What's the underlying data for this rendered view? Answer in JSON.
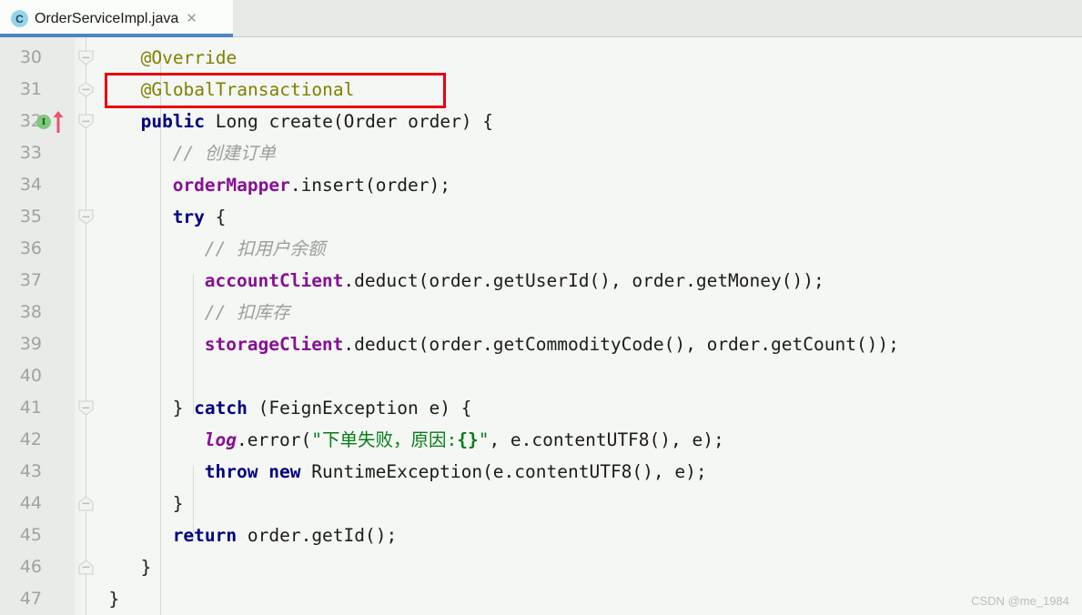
{
  "window": {
    "app": "IntelliJ IDEA Editor",
    "watermark": "CSDN @me_1984"
  },
  "tab": {
    "title": "OrderServiceImpl.java",
    "icon": "java-class-icon",
    "icon_letter": "C",
    "close_label": "✕",
    "active": true,
    "accent_color": "#4a86c4"
  },
  "colors": {
    "editor_background": "#f4f7f3",
    "gutter_background": "#e9ebe8",
    "line_number": "#9ea3a0",
    "keyword": "#000080",
    "annotation": "#808000",
    "comment": "#9aa09b",
    "field": "#871094",
    "string": "#067d17",
    "plain_text": "#1b1b1b",
    "highlight_box": "#e60012",
    "tab_accent": "#4a86c4"
  },
  "gutter": {
    "markers": [
      {
        "line": 32,
        "type": "implementing-method-badge",
        "letter": "I",
        "color": "#7dc97a"
      },
      {
        "line": 32,
        "type": "override-arrow",
        "color": "#e8566f"
      }
    ],
    "fold_handles": [
      {
        "line": 30,
        "shape": "down"
      },
      {
        "line": 31,
        "shape": "both"
      },
      {
        "line": 32,
        "shape": "down"
      },
      {
        "line": 35,
        "shape": "down"
      },
      {
        "line": 41,
        "shape": "down"
      },
      {
        "line": 44,
        "shape": "up"
      },
      {
        "line": 46,
        "shape": "up"
      }
    ]
  },
  "highlight": {
    "target_line": 31,
    "label": "GlobalTransactional annotation highlight"
  },
  "code": {
    "first_line_number": 30,
    "line_height_px": 35,
    "lines": [
      {
        "n": 30,
        "indent": 8,
        "tokens": [
          {
            "t": "@Override",
            "c": "anno"
          }
        ]
      },
      {
        "n": 31,
        "indent": 8,
        "tokens": [
          {
            "t": "@GlobalTransactional",
            "c": "anno"
          }
        ]
      },
      {
        "n": 32,
        "indent": 8,
        "tokens": [
          {
            "t": "public",
            "c": "kw"
          },
          {
            "t": " Long create(Order order) {",
            "c": "plain"
          }
        ]
      },
      {
        "n": 33,
        "indent": 11,
        "tokens": [
          {
            "t": "// 创建订单",
            "c": "comment"
          }
        ]
      },
      {
        "n": 34,
        "indent": 11,
        "tokens": [
          {
            "t": "orderMapper",
            "c": "field"
          },
          {
            "t": ".insert(order);",
            "c": "plain"
          }
        ]
      },
      {
        "n": 35,
        "indent": 11,
        "tokens": [
          {
            "t": "try",
            "c": "kw"
          },
          {
            "t": " {",
            "c": "plain"
          }
        ]
      },
      {
        "n": 36,
        "indent": 14,
        "tokens": [
          {
            "t": "// 扣用户余额",
            "c": "comment"
          }
        ]
      },
      {
        "n": 37,
        "indent": 14,
        "tokens": [
          {
            "t": "accountClient",
            "c": "field"
          },
          {
            "t": ".deduct(order.getUserId(), order.getMoney());",
            "c": "plain"
          }
        ]
      },
      {
        "n": 38,
        "indent": 14,
        "tokens": [
          {
            "t": "// 扣库存",
            "c": "comment"
          }
        ]
      },
      {
        "n": 39,
        "indent": 14,
        "tokens": [
          {
            "t": "storageClient",
            "c": "field"
          },
          {
            "t": ".deduct(order.getCommodityCode(), order.getCount());",
            "c": "plain"
          }
        ]
      },
      {
        "n": 40,
        "indent": 0,
        "tokens": []
      },
      {
        "n": 41,
        "indent": 11,
        "tokens": [
          {
            "t": "} ",
            "c": "plain"
          },
          {
            "t": "catch",
            "c": "kw"
          },
          {
            "t": " (FeignException e) {",
            "c": "plain"
          }
        ]
      },
      {
        "n": 42,
        "indent": 14,
        "tokens": [
          {
            "t": "log",
            "c": "sfield"
          },
          {
            "t": ".error(",
            "c": "plain"
          },
          {
            "t": "\"下单失败，原因:",
            "c": "str"
          },
          {
            "t": "{}",
            "c": "strfmt"
          },
          {
            "t": "\"",
            "c": "str"
          },
          {
            "t": ", e.contentUTF8(), e);",
            "c": "plain"
          }
        ]
      },
      {
        "n": 43,
        "indent": 14,
        "tokens": [
          {
            "t": "throw",
            "c": "kw"
          },
          {
            "t": " ",
            "c": "plain"
          },
          {
            "t": "new",
            "c": "kw"
          },
          {
            "t": " RuntimeException(e.contentUTF8(), e);",
            "c": "plain"
          }
        ]
      },
      {
        "n": 44,
        "indent": 11,
        "tokens": [
          {
            "t": "}",
            "c": "plain"
          }
        ]
      },
      {
        "n": 45,
        "indent": 11,
        "tokens": [
          {
            "t": "return",
            "c": "kw"
          },
          {
            "t": " order.getId();",
            "c": "plain"
          }
        ]
      },
      {
        "n": 46,
        "indent": 8,
        "tokens": [
          {
            "t": "}",
            "c": "plain"
          }
        ]
      },
      {
        "n": 47,
        "indent": 5,
        "tokens": [
          {
            "t": "}",
            "c": "plain"
          }
        ]
      }
    ]
  }
}
